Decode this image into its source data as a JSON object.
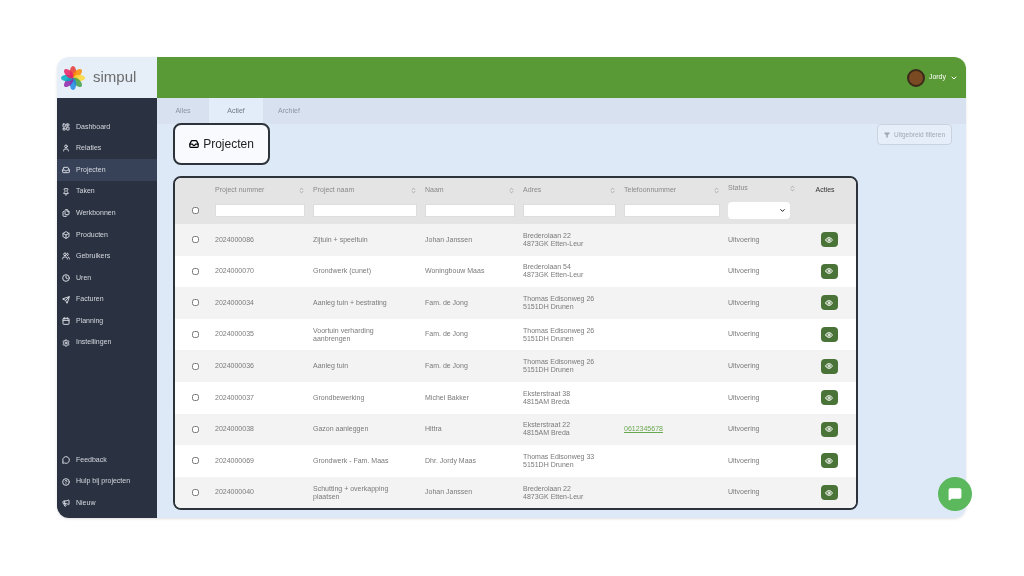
{
  "brand": {
    "name": "simpul"
  },
  "user": {
    "name": "Jordy"
  },
  "sidebar": {
    "items": [
      {
        "label": "Dashboard",
        "selected": false
      },
      {
        "label": "Relaties",
        "selected": false
      },
      {
        "label": "Projecten",
        "selected": true
      },
      {
        "label": "Taken",
        "selected": false
      },
      {
        "label": "Werkbonnen",
        "selected": false
      },
      {
        "label": "Producten",
        "selected": false
      },
      {
        "label": "Gebruikers",
        "selected": false
      },
      {
        "label": "Uren",
        "selected": false
      },
      {
        "label": "Facturen",
        "selected": false
      },
      {
        "label": "Planning",
        "selected": false
      },
      {
        "label": "Instellingen",
        "selected": false
      }
    ],
    "footer_items": [
      {
        "label": "Feedback"
      },
      {
        "label": "Hulp bij projecten"
      },
      {
        "label": "Nieuw"
      }
    ]
  },
  "tabs": [
    {
      "label": "Alles",
      "selected": false
    },
    {
      "label": "Actief",
      "selected": true
    },
    {
      "label": "Archief",
      "selected": false
    }
  ],
  "page_title": "Projecten",
  "filter_button": "Uitgebreid filteren",
  "table": {
    "select_all_checked": false,
    "columns": [
      {
        "label": "Project nummer",
        "kind": "text"
      },
      {
        "label": "Project naam",
        "kind": "text"
      },
      {
        "label": "Naam",
        "kind": "text"
      },
      {
        "label": "Adres",
        "kind": "text"
      },
      {
        "label": "Telefoonnummer",
        "kind": "text"
      },
      {
        "label": "Status",
        "kind": "select"
      },
      {
        "label": "Acties",
        "kind": "actions"
      }
    ],
    "rows": [
      {
        "number": "2024000086",
        "project": "Zijtuin + speeltuin",
        "name": "Johan Janssen",
        "address": [
          "Brederolaan 22",
          "4873GK Etten-Leur"
        ],
        "status": "Uitvoering",
        "checked": false
      },
      {
        "number": "2024000070",
        "project": "Grondwerk (cunet)",
        "name": "Woningbouw Maas",
        "address": [
          "Brederolaan 54",
          "4873GK Etten-Leur"
        ],
        "status": "Uitvoering",
        "checked": false
      },
      {
        "number": "2024000034",
        "project": "Aanleg tuin + bestrating",
        "name": "Fam. de Jong",
        "address": [
          "Thomas Edisonweg 26",
          "5151DH Drunen"
        ],
        "status": "Uitvoering",
        "checked": false
      },
      {
        "number": "2024000035",
        "project": "Voortuin verharding aanbrengen",
        "name": "Fam. de Jong",
        "address": [
          "Thomas Edisonweg 26",
          "5151DH Drunen"
        ],
        "status": "Uitvoering",
        "checked": false
      },
      {
        "number": "2024000036",
        "project": "Aanleg tuin",
        "name": "Fam. de Jong",
        "address": [
          "Thomas Edisonweg 26",
          "5151DH Drunen"
        ],
        "status": "Uitvoering",
        "checked": false
      },
      {
        "number": "2024000037",
        "project": "Grondbewerking",
        "name": "Michel Bakker",
        "address": [
          "Eksterstraat 38",
          "4815AM Breda"
        ],
        "status": "Uitvoering",
        "checked": false
      },
      {
        "number": "2024000038",
        "project": "Gazon aanleggen",
        "name": "Hittra",
        "address": [
          "Eksterstraat 22",
          "4815AM Breda"
        ],
        "phone": "0612345678",
        "status": "Uitvoering",
        "checked": false
      },
      {
        "number": "2024000069",
        "project": "Grondwerk - Fam. Maas",
        "name": "Dhr. Jordy Maas",
        "address": [
          "Thomas Edisonweg 33",
          "5151DH Drunen"
        ],
        "status": "Uitvoering",
        "checked": false
      },
      {
        "number": "2024000040",
        "project": "Schutting + overkapping plaatsen",
        "name": "Johan Janssen",
        "address": [
          "Brederolaan 22",
          "4873GK Etten-Leur"
        ],
        "status": "Uitvoering",
        "checked": false
      }
    ]
  }
}
